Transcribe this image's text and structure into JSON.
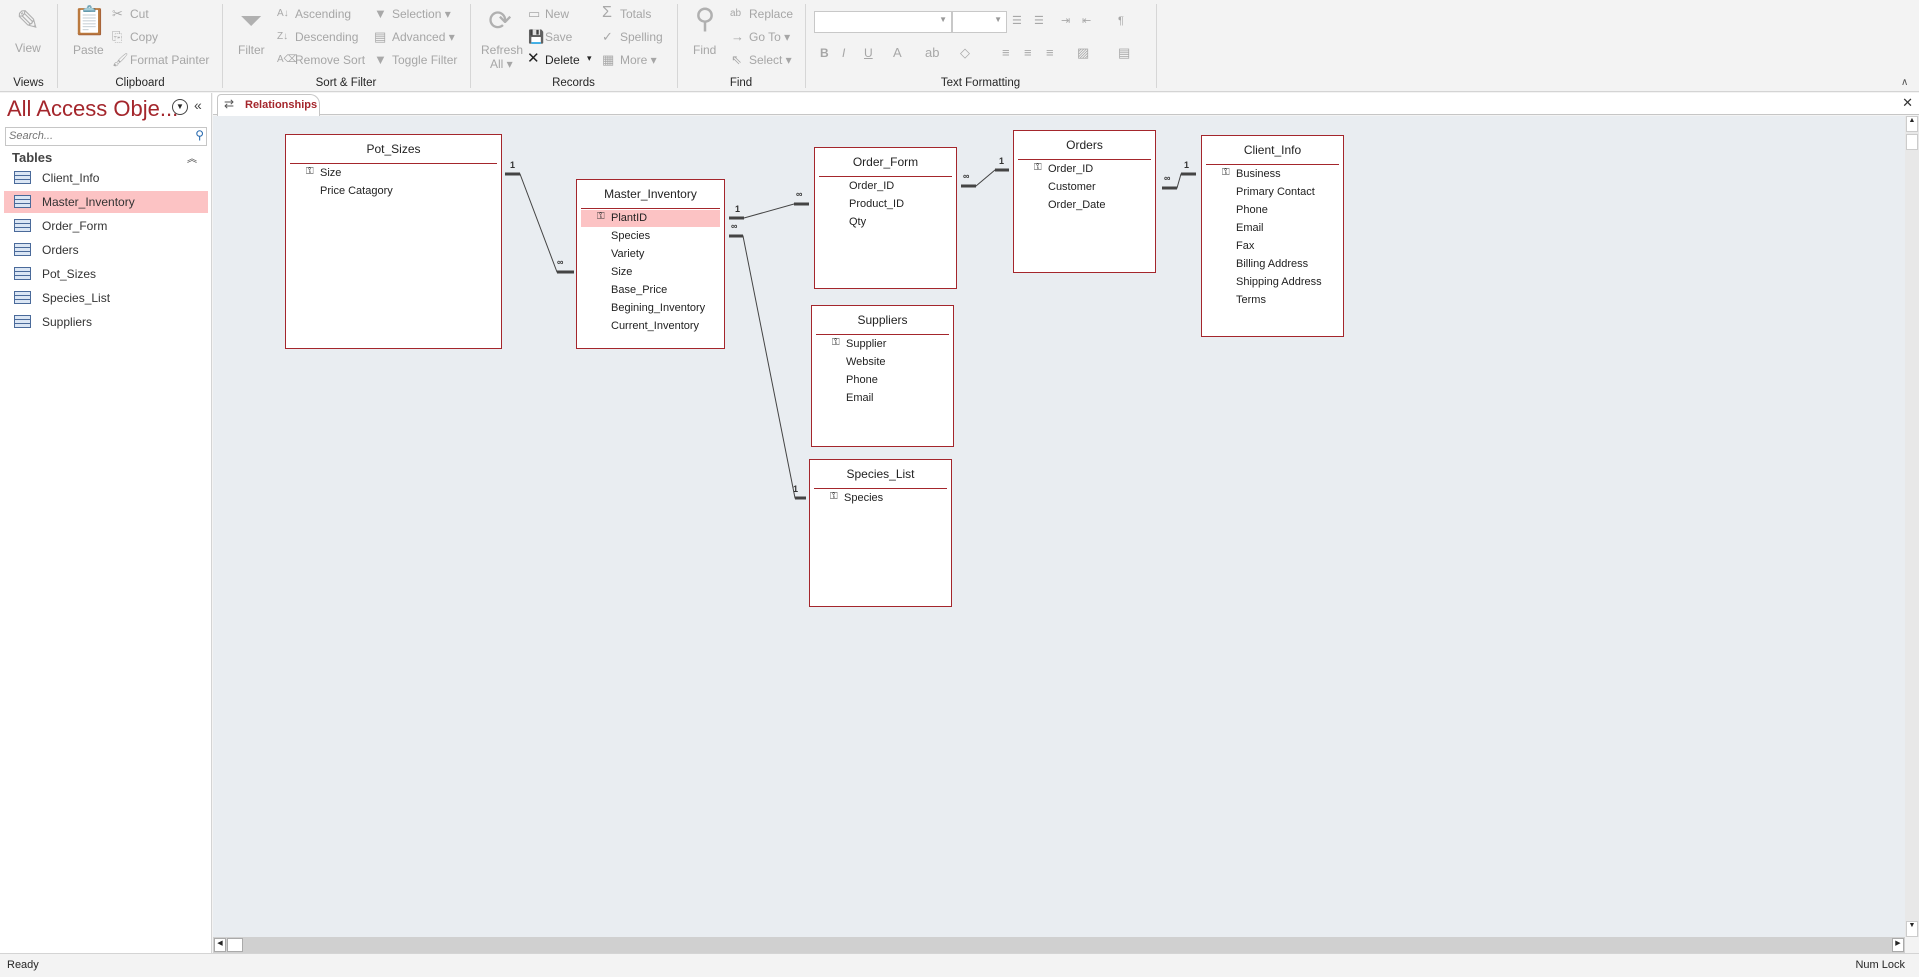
{
  "ribbon": {
    "views": {
      "label": "Views",
      "view": "View"
    },
    "clipboard": {
      "label": "Clipboard",
      "paste": "Paste",
      "cut": "Cut",
      "copy": "Copy",
      "format_painter": "Format Painter"
    },
    "sort_filter": {
      "label": "Sort & Filter",
      "filter": "Filter",
      "ascending": "Ascending",
      "descending": "Descending",
      "remove_sort": "Remove Sort",
      "selection": "Selection ▾",
      "advanced": "Advanced ▾",
      "toggle_filter": "Toggle Filter"
    },
    "records": {
      "label": "Records",
      "refresh": "Refresh",
      "refresh_all": "All ▾",
      "new": "New",
      "save": "Save",
      "delete": "Delete",
      "delete_arrow": "▾",
      "totals": "Totals",
      "spelling": "Spelling",
      "more": "More ▾"
    },
    "find": {
      "label": "Find",
      "find": "Find",
      "replace": "Replace",
      "go_to": "Go To ▾",
      "select": "Select ▾"
    },
    "text_formatting": {
      "label": "Text Formatting",
      "bold": "B",
      "italic": "I",
      "underline": "U",
      "font_value": "",
      "size_value": ""
    }
  },
  "nav": {
    "title": "All Access Obje...",
    "search_placeholder": "Search...",
    "section": "Tables",
    "items": [
      {
        "label": "Client_Info"
      },
      {
        "label": "Master_Inventory"
      },
      {
        "label": "Order_Form"
      },
      {
        "label": "Orders"
      },
      {
        "label": "Pot_Sizes"
      },
      {
        "label": "Species_List"
      },
      {
        "label": "Suppliers"
      }
    ]
  },
  "tab": {
    "label": "Relationships"
  },
  "tables": {
    "pot_sizes": {
      "title": "Pot_Sizes",
      "fields": [
        {
          "name": "Size",
          "key": true
        },
        {
          "name": "Price Catagory"
        }
      ]
    },
    "master_inventory": {
      "title": "Master_Inventory",
      "fields": [
        {
          "name": "PlantID",
          "key": true
        },
        {
          "name": "Species"
        },
        {
          "name": "Variety"
        },
        {
          "name": "Size"
        },
        {
          "name": "Base_Price"
        },
        {
          "name": "Begining_Inventory"
        },
        {
          "name": "Current_Inventory"
        }
      ]
    },
    "order_form": {
      "title": "Order_Form",
      "fields": [
        {
          "name": "Order_ID"
        },
        {
          "name": "Product_ID"
        },
        {
          "name": "Qty"
        }
      ]
    },
    "orders": {
      "title": "Orders",
      "fields": [
        {
          "name": "Order_ID",
          "key": true
        },
        {
          "name": "Customer"
        },
        {
          "name": "Order_Date"
        }
      ]
    },
    "client_info": {
      "title": "Client_Info",
      "fields": [
        {
          "name": "Business",
          "key": true
        },
        {
          "name": "Primary Contact"
        },
        {
          "name": "Phone"
        },
        {
          "name": "Email"
        },
        {
          "name": "Fax"
        },
        {
          "name": "Billing Address"
        },
        {
          "name": "Shipping Address"
        },
        {
          "name": "Terms"
        }
      ]
    },
    "suppliers": {
      "title": "Suppliers",
      "fields": [
        {
          "name": "Supplier",
          "key": true
        },
        {
          "name": "Website"
        },
        {
          "name": "Phone"
        },
        {
          "name": "Email"
        }
      ]
    },
    "species_list": {
      "title": "Species_List",
      "fields": [
        {
          "name": "Species",
          "key": true
        }
      ]
    }
  },
  "relationships": [
    {
      "one": "1",
      "many": "∞"
    },
    {
      "one": "1",
      "many": "∞"
    },
    {
      "one": "1",
      "many": "∞"
    },
    {
      "one": "1",
      "many": "∞"
    },
    {
      "one": "1",
      "many": "∞"
    }
  ],
  "status": {
    "left": "Ready",
    "right": "Num Lock"
  },
  "colors": {
    "accent": "#a4262c",
    "selection": "#fcc3c4",
    "canvas": "#e9edf1"
  }
}
